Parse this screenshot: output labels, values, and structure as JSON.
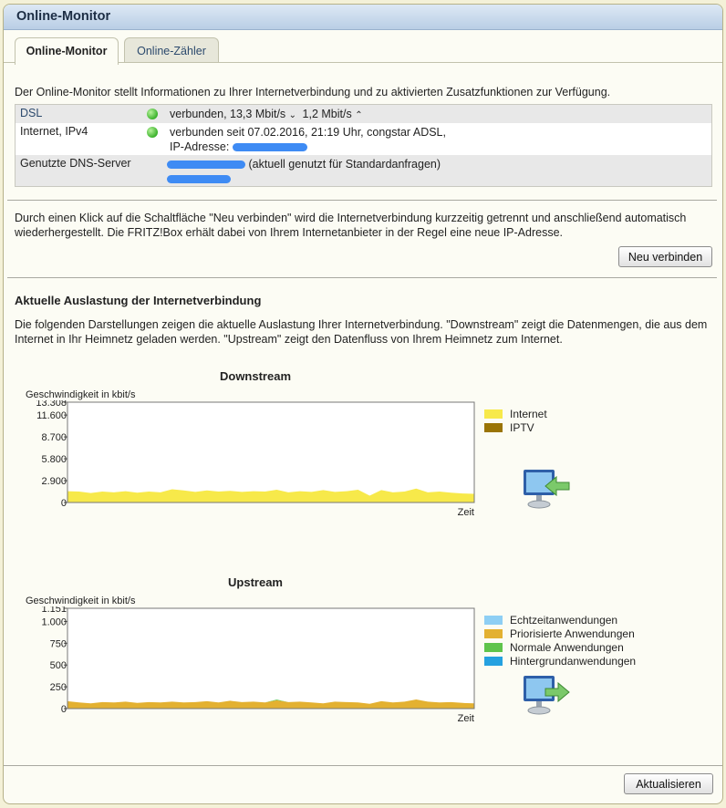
{
  "window": {
    "title": "Online-Monitor"
  },
  "tabs": [
    {
      "label": "Online-Monitor",
      "active": true
    },
    {
      "label": "Online-Zähler",
      "active": false
    }
  ],
  "intro": "Der Online-Monitor stellt Informationen zu Ihrer Internetverbindung und zu aktivierten Zusatzfunktionen zur Verfügung.",
  "status": {
    "dsl": {
      "label": "DSL",
      "state": "verbunden, 13,3 Mbit/s",
      "down_arrow": "⌄",
      "upstream": "1,2 Mbit/s",
      "up_arrow": "⌃"
    },
    "internet": {
      "label": "Internet, IPv4",
      "state": "verbunden seit 07.02.2016, 21:19 Uhr, congstar ADSL,",
      "ip_label": "IP-Adresse:"
    },
    "dns": {
      "label": "Genutzte DNS-Server",
      "note": "(aktuell genutzt für Standardanfragen)"
    }
  },
  "reconnect": {
    "text": "Durch einen Klick auf die Schaltfläche \"Neu verbinden\" wird die Internetverbindung kurzzeitig getrennt und anschließend automatisch wiederhergestellt. Die FRITZ!Box erhält dabei von Ihrem Internetanbieter in der Regel eine neue IP-Adresse.",
    "button": "Neu verbinden"
  },
  "load": {
    "heading": "Aktuelle Auslastung der Internetverbindung",
    "text": "Die folgenden Darstellungen zeigen die aktuelle Auslastung Ihrer Internetverbindung. \"Downstream\" zeigt die Datenmengen, die aus dem Internet in Ihr Heimnetz geladen werden. \"Upstream\" zeigt den Datenfluss von Ihrem Heimnetz zum Internet."
  },
  "colors": {
    "internet": "#f7e94a",
    "iptv": "#9a7405",
    "echtzeit": "#8ecff4",
    "priorisiert": "#e3b131",
    "normal": "#5fc44b",
    "hintergrund": "#25a1e0"
  },
  "chart_data": [
    {
      "type": "area",
      "title": "Downstream",
      "ylabel": "Geschwindigkeit in kbit/s",
      "xlabel": "Zeit",
      "ylim": [
        0,
        13308
      ],
      "yticks": [
        "13.308",
        "11.600",
        "8.700",
        "5.800",
        "2.900",
        "0"
      ],
      "ytick_values": [
        13308,
        11600,
        8700,
        5800,
        2900,
        0
      ],
      "series": [
        {
          "name": "Internet",
          "color": "#f7e94a",
          "values": [
            1500,
            1450,
            1250,
            1450,
            1350,
            1500,
            1300,
            1450,
            1350,
            1750,
            1600,
            1400,
            1600,
            1450,
            1550,
            1400,
            1500,
            1450,
            1700,
            1350,
            1500,
            1400,
            1650,
            1400,
            1500,
            1700,
            900,
            1650,
            1350,
            1450,
            1850,
            1350,
            1450,
            1300,
            1200,
            1150
          ]
        },
        {
          "name": "IPTV",
          "color": "#9a7405",
          "values": []
        }
      ]
    },
    {
      "type": "area",
      "title": "Upstream",
      "ylabel": "Geschwindigkeit in kbit/s",
      "xlabel": "Zeit",
      "ylim": [
        0,
        1151
      ],
      "yticks": [
        "1.151",
        "1.000",
        "750",
        "500",
        "250",
        "0"
      ],
      "ytick_values": [
        1151,
        1000,
        750,
        500,
        250,
        0
      ],
      "series": [
        {
          "name": "Echtzeitanwendungen",
          "color": "#8ecff4",
          "values": []
        },
        {
          "name": "Priorisierte Anwendungen",
          "color": "#e3b131",
          "values": [
            85,
            70,
            60,
            75,
            70,
            80,
            65,
            75,
            70,
            80,
            70,
            75,
            85,
            70,
            90,
            75,
            80,
            70,
            95,
            75,
            80,
            70,
            60,
            80,
            75,
            70,
            55,
            85,
            70,
            80,
            105,
            80,
            70,
            75,
            65,
            60
          ]
        },
        {
          "name": "Normale Anwendungen",
          "color": "#5fc44b",
          "values": [
            0,
            0,
            0,
            0,
            0,
            0,
            0,
            0,
            0,
            0,
            0,
            0,
            0,
            0,
            0,
            0,
            0,
            0,
            8,
            0,
            0,
            0,
            0,
            0,
            0,
            0,
            0,
            0,
            0,
            0,
            0,
            0,
            0,
            0,
            0,
            0
          ]
        },
        {
          "name": "Hintergrundanwendungen",
          "color": "#25a1e0",
          "values": []
        }
      ]
    }
  ],
  "footer": {
    "refresh_button": "Aktualisieren"
  }
}
